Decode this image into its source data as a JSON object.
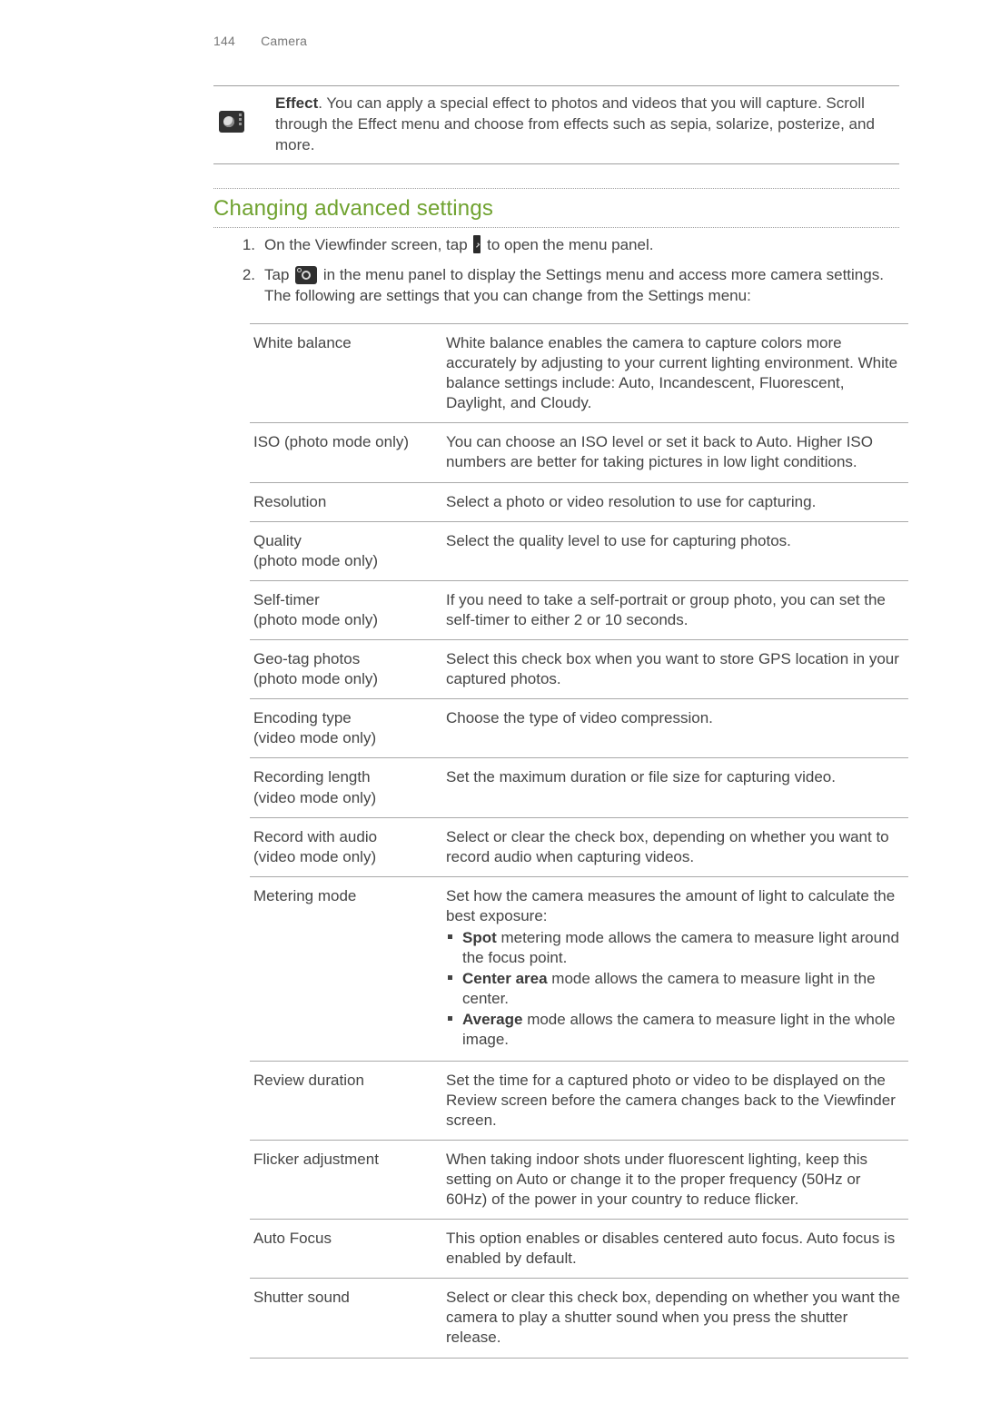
{
  "header": {
    "page_number": "144",
    "chapter": "Camera"
  },
  "effect_row": {
    "label": "Effect",
    "text_rest": ". You can apply a special effect to photos and videos that you will capture. Scroll through the Effect menu and choose from effects such as sepia, solarize, posterize, and more."
  },
  "section_title": "Changing advanced settings",
  "steps": [
    {
      "num": "1.",
      "before": "On the Viewfinder screen, tap ",
      "after": " to open the menu panel.",
      "icon": "tab"
    },
    {
      "num": "2.",
      "before": "Tap ",
      "after": " in the menu panel to display the Settings menu and access more camera settings. The following are settings that you can change from the Settings menu:",
      "icon": "settings"
    }
  ],
  "settings": [
    {
      "label_main": "White balance",
      "label_sub": "",
      "desc_plain": "White balance enables the camera to capture colors more accurately by adjusting to your current lighting environment. White balance settings include: Auto, Incandescent, Fluorescent, Daylight, and Cloudy."
    },
    {
      "label_main": "ISO (photo mode only)",
      "label_sub": "",
      "desc_plain": "You can choose an ISO level or set it back to Auto. Higher ISO numbers are better for taking pictures in low light conditions."
    },
    {
      "label_main": "Resolution",
      "label_sub": "",
      "desc_plain": "Select a photo or video resolution to use for capturing."
    },
    {
      "label_main": "Quality",
      "label_sub": "(photo mode only)",
      "desc_plain": "Select the quality level to use for capturing photos."
    },
    {
      "label_main": "Self-timer",
      "label_sub": "(photo mode only)",
      "desc_plain": "If you need to take a self-portrait or group photo, you can set the self-timer to either 2 or 10 seconds."
    },
    {
      "label_main": "Geo-tag photos",
      "label_sub": "(photo mode only)",
      "desc_plain": "Select this check box when you want to store GPS location in your captured photos."
    },
    {
      "label_main": "Encoding type",
      "label_sub": "(video mode only)",
      "desc_plain": "Choose the type of video compression."
    },
    {
      "label_main": "Recording length",
      "label_sub": "(video mode only)",
      "desc_plain": "Set the maximum duration or file size for capturing video."
    },
    {
      "label_main": "Record with audio",
      "label_sub": "(video mode only)",
      "desc_plain": "Select or clear the check box, depending on whether you want to record audio when capturing videos."
    },
    {
      "label_main": "Metering mode",
      "label_sub": "",
      "desc_intro": "Set how the camera measures the amount of light to calculate the best exposure:",
      "bullets": [
        {
          "bold": "Spot",
          "rest": " metering mode allows the camera to measure light around the focus point."
        },
        {
          "bold": "Center area",
          "rest": " mode allows the camera to measure light in the center."
        },
        {
          "bold": "Average",
          "rest": " mode allows the camera to measure light in the whole image."
        }
      ]
    },
    {
      "label_main": "Review duration",
      "label_sub": "",
      "desc_plain": "Set the time for a captured photo or video to be displayed on the Review screen before the camera changes back to the Viewfinder screen."
    },
    {
      "label_main": "Flicker adjustment",
      "label_sub": "",
      "desc_plain": "When taking indoor shots under fluorescent lighting, keep this setting on Auto or change it to the proper frequency (50Hz or 60Hz) of the power in your country to reduce flicker."
    },
    {
      "label_main": "Auto Focus",
      "label_sub": "",
      "desc_plain": "This option enables or disables centered auto focus. Auto focus is enabled by default."
    },
    {
      "label_main": "Shutter sound",
      "label_sub": "",
      "desc_plain": "Select or clear this check box, depending on whether you want the camera to play a shutter sound when you press the shutter release."
    }
  ]
}
